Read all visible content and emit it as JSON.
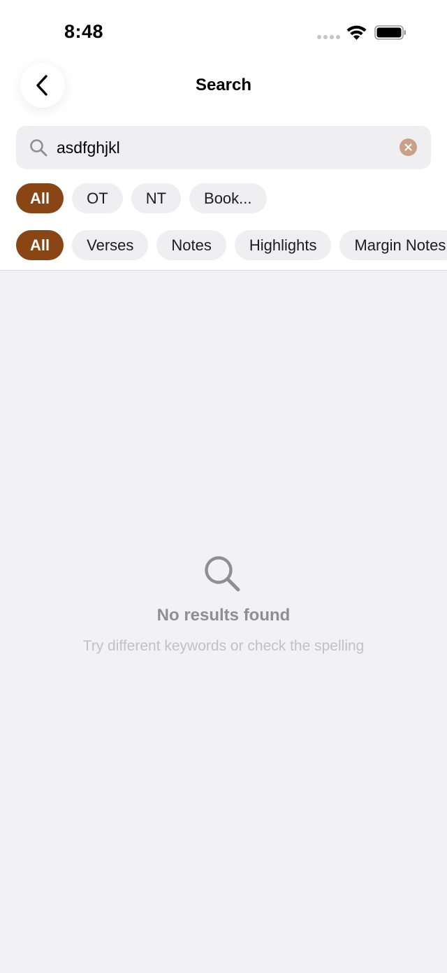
{
  "status_bar": {
    "time": "8:48"
  },
  "header": {
    "title": "Search"
  },
  "search": {
    "value": "asdfghjkl"
  },
  "scope_filters": [
    {
      "label": "All",
      "active": true
    },
    {
      "label": "OT",
      "active": false
    },
    {
      "label": "NT",
      "active": false
    },
    {
      "label": "Book...",
      "active": false
    }
  ],
  "type_filters": [
    {
      "label": "All",
      "active": true
    },
    {
      "label": "Verses",
      "active": false
    },
    {
      "label": "Notes",
      "active": false
    },
    {
      "label": "Highlights",
      "active": false
    },
    {
      "label": "Margin Notes",
      "active": false
    }
  ],
  "empty_state": {
    "title": "No results found",
    "subtitle": "Try different keywords or check the spelling"
  },
  "colors": {
    "accent": "#8a4515",
    "clear_button": "#c9a089",
    "background": "#f1f1f6",
    "chip_bg": "#efeff1"
  },
  "icons": {
    "back": "chevron-left-icon",
    "search": "search-icon",
    "clear": "clear-icon",
    "empty": "search-icon"
  }
}
